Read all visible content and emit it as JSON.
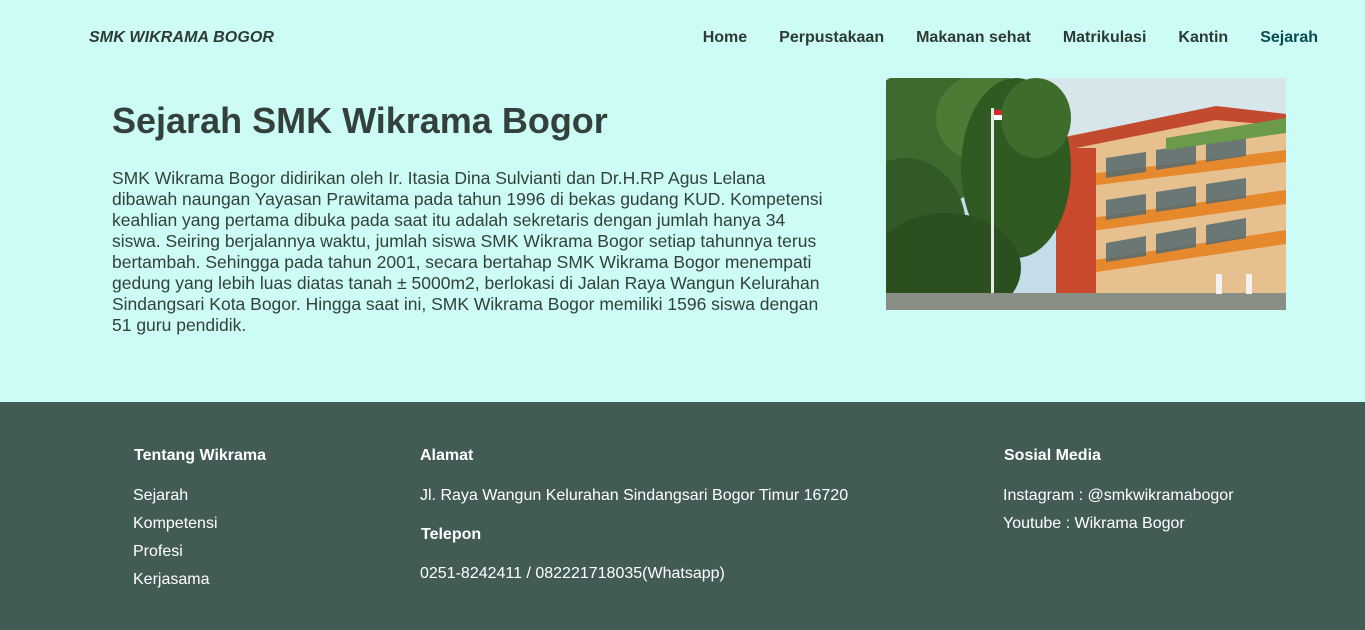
{
  "header": {
    "brand": "SMK WIKRAMA BOGOR",
    "nav": [
      {
        "label": "Home"
      },
      {
        "label": "Perpustakaan"
      },
      {
        "label": "Makanan sehat"
      },
      {
        "label": "Matrikulasi"
      },
      {
        "label": "Kantin"
      },
      {
        "label": "Sejarah",
        "active": true
      }
    ]
  },
  "main": {
    "title": "Sejarah SMK Wikrama Bogor",
    "paragraph": "SMK Wikrama Bogor didirikan oleh Ir. Itasia Dina Sulvianti dan Dr.H.RP Agus Lelana dibawah naungan Yayasan Prawitama pada tahun 1996 di bekas gudang KUD. Kompetensi keahlian yang pertama dibuka pada saat itu adalah sekretaris dengan jumlah hanya 34 siswa. Seiring berjalannya waktu, jumlah siswa SMK Wikrama Bogor setiap tahunnya terus bertambah. Sehingga pada tahun 2001, secara bertahap SMK Wikrama Bogor menempati gedung yang lebih luas diatas tanah ± 5000m2, berlokasi di Jalan Raya Wangun Kelurahan Sindangsari Kota Bogor. Hingga saat ini, SMK Wikrama Bogor memiliki 1596 siswa dengan 51 guru pendidik."
  },
  "footer": {
    "about": {
      "heading": "Tentang Wikrama",
      "links": [
        "Sejarah",
        "Kompetensi",
        "Profesi",
        "Kerjasama"
      ]
    },
    "address": {
      "heading": "Alamat",
      "text": "Jl. Raya Wangun Kelurahan Sindangsari Bogor Timur 16720"
    },
    "phone": {
      "heading": "Telepon",
      "text": "0251-8242411 / 082221718035(Whatsapp)"
    },
    "social": {
      "heading": "Sosial Media",
      "instagram": "Instagram : @smkwikramabogor",
      "youtube": "Youtube : Wikrama Bogor"
    }
  },
  "colors": {
    "page_bg": "#ccfcf5",
    "footer_bg": "#425c55",
    "text_dark": "#33403c",
    "nav_active": "#0a4a52"
  }
}
